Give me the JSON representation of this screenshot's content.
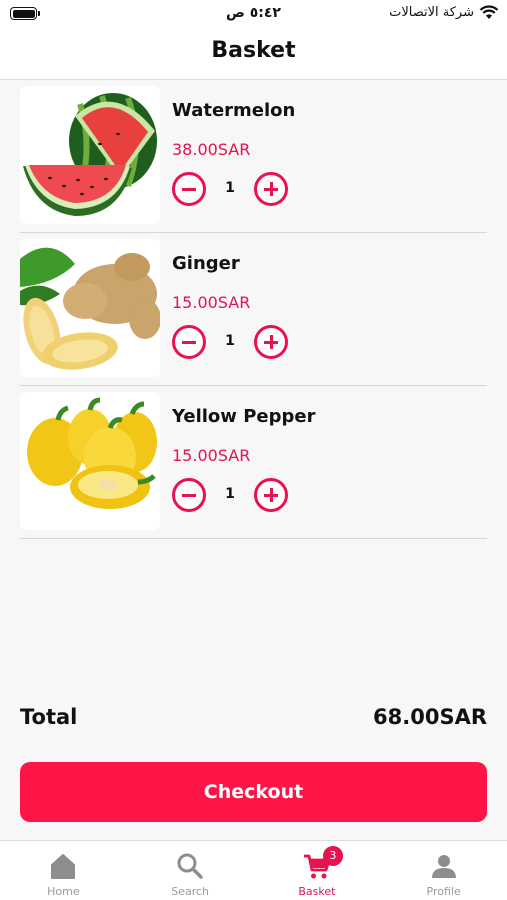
{
  "status_bar": {
    "time": "٥:٤٢ ص",
    "carrier": "شركة الاتصالات"
  },
  "header": {
    "title": "Basket"
  },
  "items": [
    {
      "name": "Watermelon",
      "price": "38.00SAR",
      "quantity": "1",
      "image_icon": "watermelon-image"
    },
    {
      "name": "Ginger",
      "price": "15.00SAR",
      "quantity": "1",
      "image_icon": "ginger-image"
    },
    {
      "name": "Yellow Pepper",
      "price": "15.00SAR",
      "quantity": "1",
      "image_icon": "yellow-pepper-image"
    }
  ],
  "summary": {
    "total_label": "Total",
    "total_value": "68.00SAR"
  },
  "checkout": {
    "label": "Checkout"
  },
  "tabs": [
    {
      "label": "Home",
      "icon": "home-icon",
      "active": false
    },
    {
      "label": "Search",
      "icon": "search-icon",
      "active": false
    },
    {
      "label": "Basket",
      "icon": "cart-icon",
      "active": true,
      "badge": "3"
    },
    {
      "label": "Profile",
      "icon": "person-icon",
      "active": false
    }
  ],
  "colors": {
    "accent": "#e8124f",
    "checkout_button": "#fe1548",
    "inactive_tab": "#999999"
  }
}
